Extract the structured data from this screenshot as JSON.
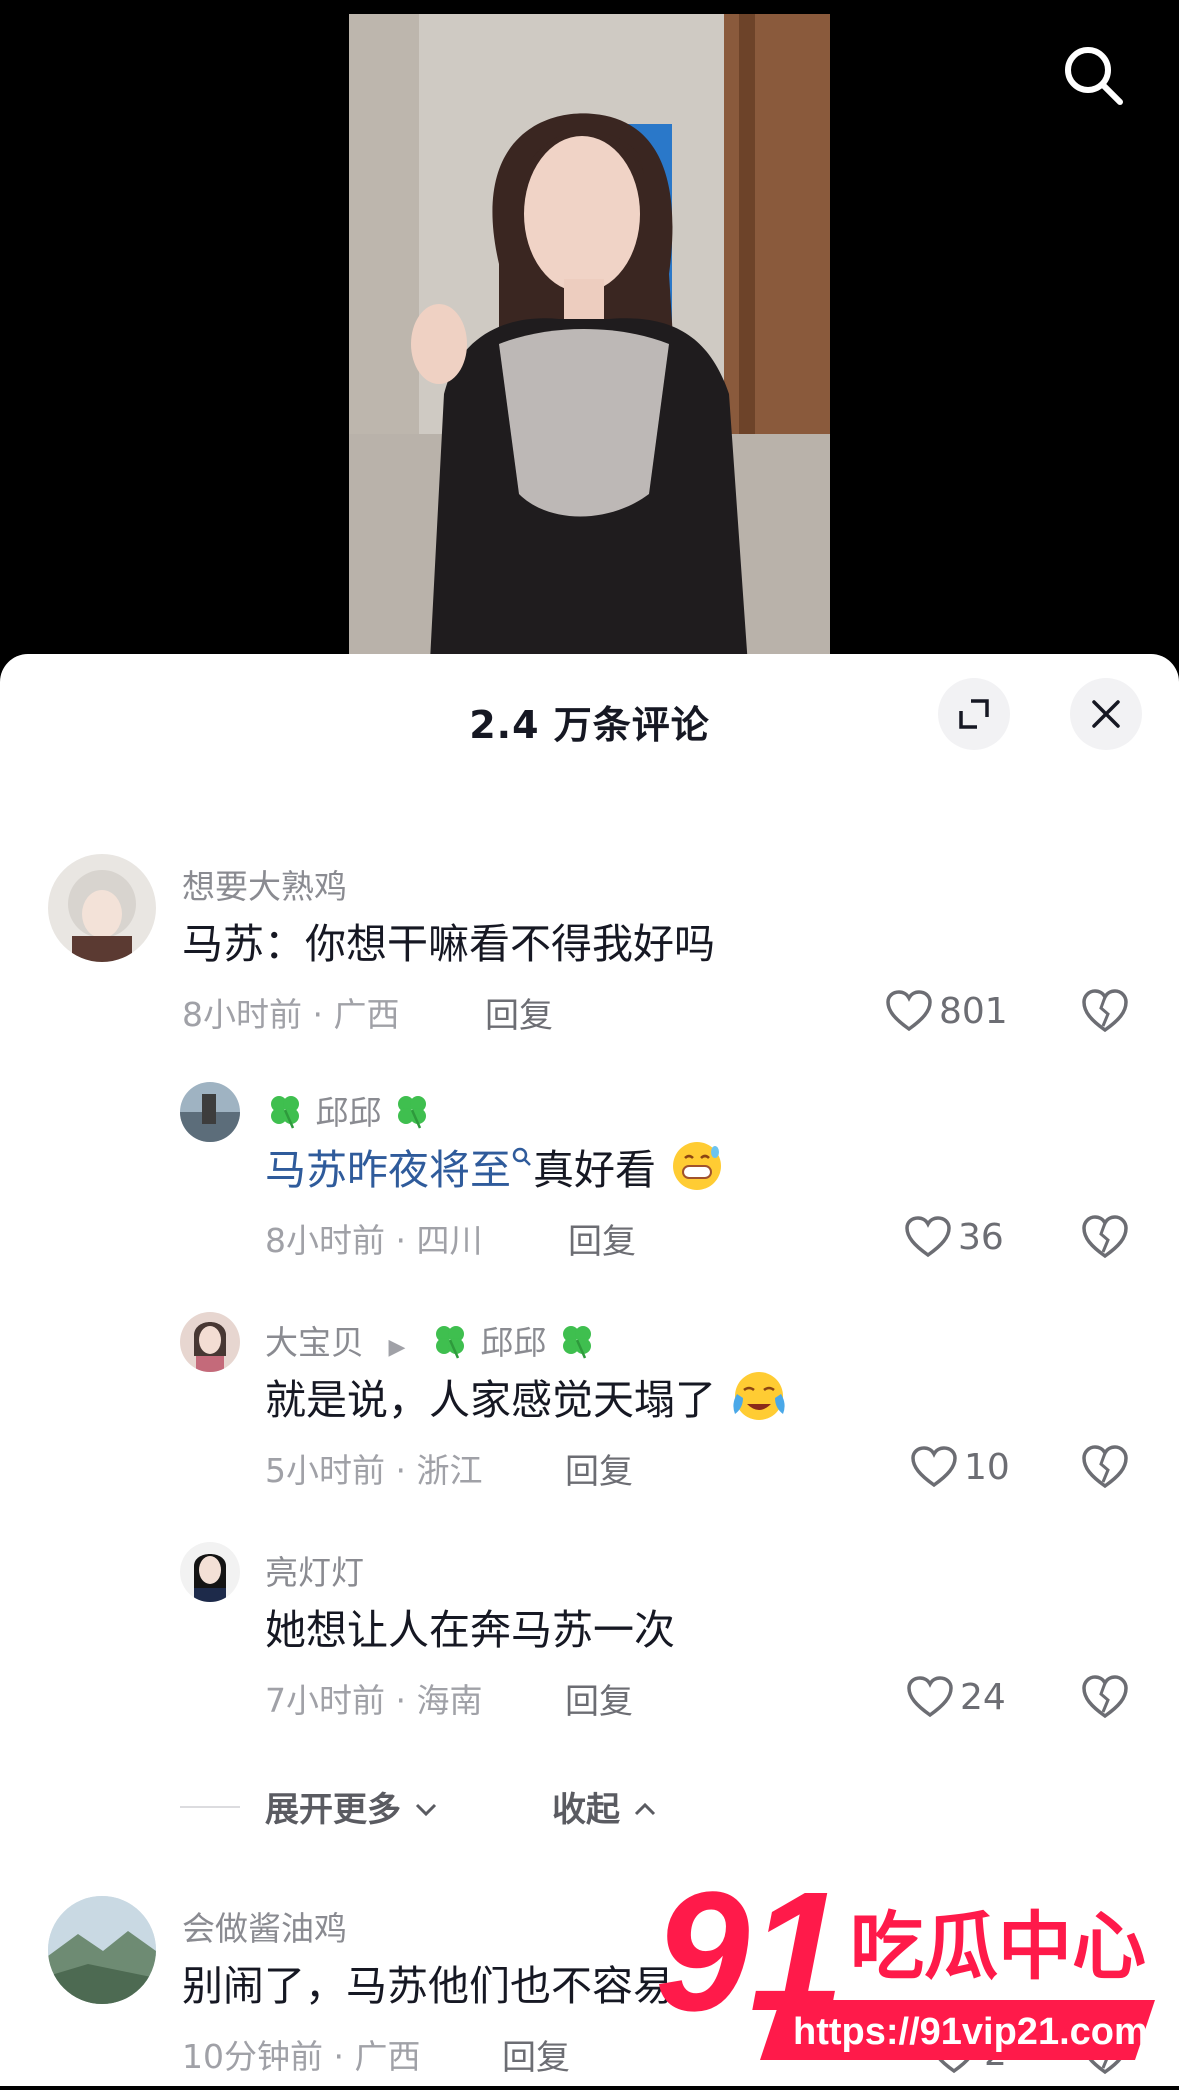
{
  "header": {
    "title": "2.4 万条评论"
  },
  "comments": [
    {
      "user": "想要大熟鸡",
      "text": "马苏：你想干嘛看不得我好吗",
      "meta": "8小时前 · 广西",
      "reply_label": "回复",
      "likes": "801"
    },
    {
      "user": "邱邱",
      "mention": "马苏昨夜将至",
      "text": "真好看",
      "meta": "8小时前 · 四川",
      "reply_label": "回复",
      "likes": "36"
    },
    {
      "user": "大宝贝",
      "reply_to": "邱邱",
      "text": "就是说，人家感觉天塌了",
      "meta": "5小时前 · 浙江",
      "reply_label": "回复",
      "likes": "10"
    },
    {
      "user": "亮灯灯",
      "text": "她想让人在奔马苏一次",
      "meta": "7小时前 · 海南",
      "reply_label": "回复",
      "likes": "24"
    },
    {
      "user": "会做酱油鸡",
      "text": "别闹了，马苏他们也不容易",
      "meta": "10分钟前 · 广西",
      "reply_label": "回复",
      "likes": "2"
    }
  ],
  "thread_controls": {
    "expand_more": "展开更多",
    "collapse": "收起"
  },
  "watermark": {
    "number": "91",
    "text": "吃瓜中心",
    "url": "https://91vip21.com"
  },
  "colors": {
    "mention": "#2f5b9b",
    "watermark": "#ff1a4a",
    "clover": "#3fbf4f"
  },
  "icons": [
    "search-icon",
    "expand-icon",
    "close-icon",
    "heart-icon",
    "broken-heart-icon",
    "clover-icon",
    "chevron-down-icon",
    "chevron-up-icon"
  ]
}
